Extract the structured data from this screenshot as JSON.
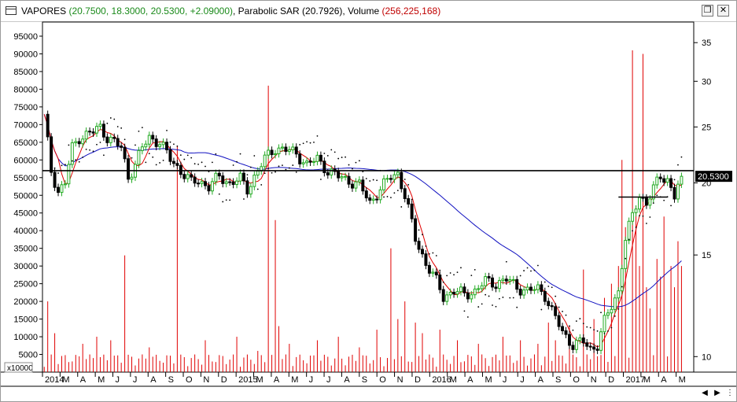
{
  "window": {
    "title_symbol": "VAPORES",
    "title_ohlc": "(20.7500, 18.3000, 20.5300, +2.09000)",
    "title_indicator": "Parabolic SAR (20.7926),",
    "title_volume_label": "Volume",
    "title_volume_value": "(256,225,168)",
    "restore_icon": "restore-icon",
    "close_icon": "close-icon"
  },
  "nav": {
    "buttons": [
      "prev-icon",
      "next-icon",
      "zoom-out-icon",
      "zoom-in-icon",
      "scroll-left-icon",
      "scroll-right-icon"
    ]
  },
  "colors": {
    "up_candle": "#22aa22",
    "down_candle": "#000000",
    "ma_fast": "#e00000",
    "ma_slow": "#1010c0",
    "sar": "#000000",
    "volume": "#e00000",
    "hline": "#000000"
  },
  "chart_data": {
    "type": "candlestick",
    "price_axis": {
      "scale": "log",
      "ticks": [
        10,
        15,
        20,
        25,
        30,
        35
      ],
      "range": [
        9.4,
        38
      ]
    },
    "volume_axis": {
      "multiplier_label": "x10000",
      "ticks": [
        5000,
        10000,
        15000,
        20000,
        25000,
        30000,
        35000,
        40000,
        45000,
        50000,
        55000,
        60000,
        65000,
        70000,
        75000,
        80000,
        85000,
        90000,
        95000
      ],
      "range": [
        0,
        99000
      ]
    },
    "x_labels": [
      "2014",
      "M",
      "A",
      "M",
      "J",
      "J",
      "A",
      "S",
      "O",
      "N",
      "D",
      "2015",
      "M",
      "A",
      "M",
      "J",
      "J",
      "A",
      "S",
      "O",
      "N",
      "D",
      "2016",
      "M",
      "A",
      "M",
      "J",
      "J",
      "A",
      "S",
      "O",
      "N",
      "D",
      "2017",
      "M",
      "A",
      "M"
    ],
    "last_price_label": "20.5300",
    "last_price": 20.53,
    "horizontal_lines": [
      {
        "price": 21.0,
        "from_week": 0,
        "to_week": 186
      },
      {
        "price": 18.9,
        "from_week": 164,
        "to_week": 178
      }
    ],
    "num_weeks": 186,
    "price_anchors": [
      [
        0,
        26
      ],
      [
        2,
        21
      ],
      [
        4,
        19.3
      ],
      [
        6,
        20
      ],
      [
        8,
        23
      ],
      [
        10,
        24
      ],
      [
        14,
        24.5
      ],
      [
        16,
        25
      ],
      [
        18,
        24
      ],
      [
        22,
        23
      ],
      [
        24,
        20.5
      ],
      [
        26,
        21.5
      ],
      [
        28,
        23
      ],
      [
        30,
        24
      ],
      [
        33,
        23.5
      ],
      [
        36,
        22
      ],
      [
        39,
        21
      ],
      [
        42,
        20
      ],
      [
        44,
        20.2
      ],
      [
        47,
        19.7
      ],
      [
        50,
        20.5
      ],
      [
        53,
        20
      ],
      [
        56,
        20.3
      ],
      [
        58,
        19.5
      ],
      [
        60,
        20.5
      ],
      [
        63,
        22
      ],
      [
        66,
        23
      ],
      [
        69,
        22.8
      ],
      [
        72,
        22.5
      ],
      [
        75,
        21.5
      ],
      [
        78,
        22
      ],
      [
        81,
        21
      ],
      [
        84,
        20.5
      ],
      [
        87,
        20.2
      ],
      [
        90,
        19.8
      ],
      [
        93,
        18.5
      ],
      [
        96,
        19.5
      ],
      [
        99,
        20.5
      ],
      [
        101,
        20.8
      ],
      [
        103,
        19
      ],
      [
        106,
        16
      ],
      [
        109,
        14.5
      ],
      [
        112,
        13.5
      ],
      [
        114,
        12.7
      ],
      [
        117,
        13
      ],
      [
        120,
        12.8
      ],
      [
        123,
        13
      ],
      [
        126,
        13.5
      ],
      [
        129,
        13.4
      ],
      [
        132,
        13.6
      ],
      [
        135,
        13.2
      ],
      [
        138,
        13
      ],
      [
        141,
        13.1
      ],
      [
        143,
        12.8
      ],
      [
        145,
        12
      ],
      [
        148,
        11
      ],
      [
        151,
        10.5
      ],
      [
        154,
        10.6
      ],
      [
        156,
        10.3
      ],
      [
        158,
        10.5
      ],
      [
        160,
        11.5
      ],
      [
        162,
        12.2
      ],
      [
        164,
        13
      ],
      [
        166,
        16
      ],
      [
        168,
        17.5
      ],
      [
        170,
        19
      ],
      [
        172,
        18.5
      ],
      [
        174,
        19.5
      ],
      [
        176,
        20.5
      ],
      [
        178,
        20.3
      ],
      [
        180,
        19
      ],
      [
        182,
        20.5
      ]
    ],
    "volume_spikes": [
      [
        1,
        20000
      ],
      [
        3,
        11000
      ],
      [
        11,
        8000
      ],
      [
        15,
        10000
      ],
      [
        19,
        9000
      ],
      [
        23,
        33000
      ],
      [
        30,
        7000
      ],
      [
        38,
        64000
      ],
      [
        46,
        9000
      ],
      [
        55,
        10000
      ],
      [
        61,
        6000
      ],
      [
        64,
        81000
      ],
      [
        66,
        43000
      ],
      [
        67,
        13000
      ],
      [
        70,
        8000
      ],
      [
        78,
        9000
      ],
      [
        84,
        10000
      ],
      [
        90,
        7000
      ],
      [
        95,
        12000
      ],
      [
        99,
        35000
      ],
      [
        101,
        15000
      ],
      [
        103,
        20000
      ],
      [
        106,
        14000
      ],
      [
        108,
        11000
      ],
      [
        113,
        12000
      ],
      [
        118,
        9000
      ],
      [
        124,
        8000
      ],
      [
        131,
        10000
      ],
      [
        136,
        9000
      ],
      [
        141,
        8000
      ],
      [
        144,
        14000
      ],
      [
        146,
        9000
      ],
      [
        150,
        13000
      ],
      [
        154,
        29000
      ],
      [
        157,
        15000
      ],
      [
        160,
        21000
      ],
      [
        162,
        25000
      ],
      [
        164,
        30000
      ],
      [
        165,
        60000
      ],
      [
        166,
        41000
      ],
      [
        168,
        91000
      ],
      [
        169,
        47000
      ],
      [
        170,
        30000
      ],
      [
        171,
        90000
      ],
      [
        172,
        24000
      ],
      [
        173,
        18000
      ],
      [
        175,
        32000
      ],
      [
        176,
        27000
      ],
      [
        177,
        44000
      ],
      [
        179,
        30000
      ],
      [
        180,
        24000
      ],
      [
        181,
        37000
      ],
      [
        182,
        30000
      ],
      [
        183,
        25000
      ]
    ],
    "ma_fast_period": 5,
    "ma_slow_period": 40
  }
}
